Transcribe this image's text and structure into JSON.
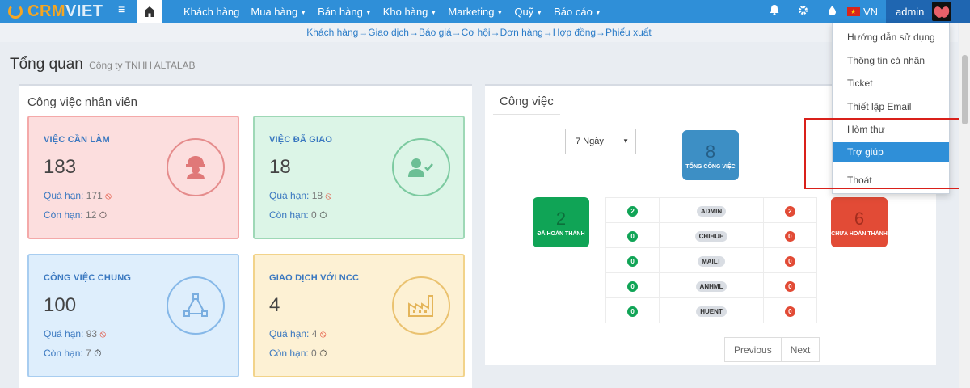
{
  "app": {
    "logo_text": "CRM",
    "logo_text2": "VIET"
  },
  "nav": {
    "menu": [
      {
        "label": "Khách hàng",
        "has_caret": false
      },
      {
        "label": "Mua hàng",
        "has_caret": true
      },
      {
        "label": "Bán hàng",
        "has_caret": true
      },
      {
        "label": "Kho hàng",
        "has_caret": true
      },
      {
        "label": "Marketing",
        "has_caret": true
      },
      {
        "label": "Quỹ",
        "has_caret": true
      },
      {
        "label": "Báo cáo",
        "has_caret": true
      }
    ],
    "language": "VN",
    "user": "admin"
  },
  "quicklinks": "Khách hàng→Giao dịch→Báo giá→Cơ hội→Đơn hàng→Hợp đồng→Phiếu xuất",
  "page": {
    "title": "Tổng quan",
    "company": "Công ty TNHH ALTALAB"
  },
  "staff_panel": {
    "title": "Công việc nhân viên",
    "overdue_label": "Quá hạn:",
    "remaining_label": "Còn hạn:",
    "cards": [
      {
        "label": "VIỆC CẦN LÀM",
        "count": "183",
        "overdue": "171",
        "remaining": "12",
        "icon": "worker-icon"
      },
      {
        "label": "VIỆC ĐÃ GIAO",
        "count": "18",
        "overdue": "18",
        "remaining": "0",
        "icon": "user-check-icon"
      },
      {
        "label": "CÔNG VIỆC CHUNG",
        "count": "100",
        "overdue": "93",
        "remaining": "7",
        "icon": "network-icon"
      },
      {
        "label": "GIAO DỊCH VỚI NCC",
        "count": "4",
        "overdue": "4",
        "remaining": "0",
        "icon": "factory-icon"
      }
    ]
  },
  "tasks_panel": {
    "title": "Công việc",
    "period": "7 Ngày",
    "total": {
      "value": "8",
      "label": "TỔNG CÔNG VIỆC"
    },
    "done": {
      "value": "2",
      "label": "ĐÃ HOÀN THÀNH"
    },
    "pending": {
      "value": "6",
      "label": "CHƯA HOÀN THÀNH"
    },
    "rows": [
      {
        "done": "2",
        "user": "ADMIN",
        "pending": "2"
      },
      {
        "done": "0",
        "user": "CHIHUE",
        "pending": "0"
      },
      {
        "done": "0",
        "user": "MAILT",
        "pending": "0"
      },
      {
        "done": "0",
        "user": "ANHML",
        "pending": "0"
      },
      {
        "done": "0",
        "user": "HUENT",
        "pending": "0"
      }
    ],
    "prev_label": "Previous",
    "next_label": "Next"
  },
  "user_menu": {
    "items": [
      {
        "label": "Hướng dẫn sử dụng",
        "active": false
      },
      {
        "label": "Thông tin cá nhân",
        "active": false
      },
      {
        "label": "Ticket",
        "active": false
      },
      {
        "label": "Thiết lập Email",
        "active": false
      },
      {
        "label": "Hòm thư",
        "active": false
      },
      {
        "label": "Trợ giúp",
        "active": true
      },
      {
        "label": "Thoát",
        "active": false
      }
    ]
  },
  "colors": {
    "nav": "#2f8fd8",
    "accent_orange": "#f5a623",
    "done_green": "#10a456",
    "pending_red": "#e24b36",
    "total_blue": "#3d8fc5",
    "highlight": "#d9201a"
  }
}
